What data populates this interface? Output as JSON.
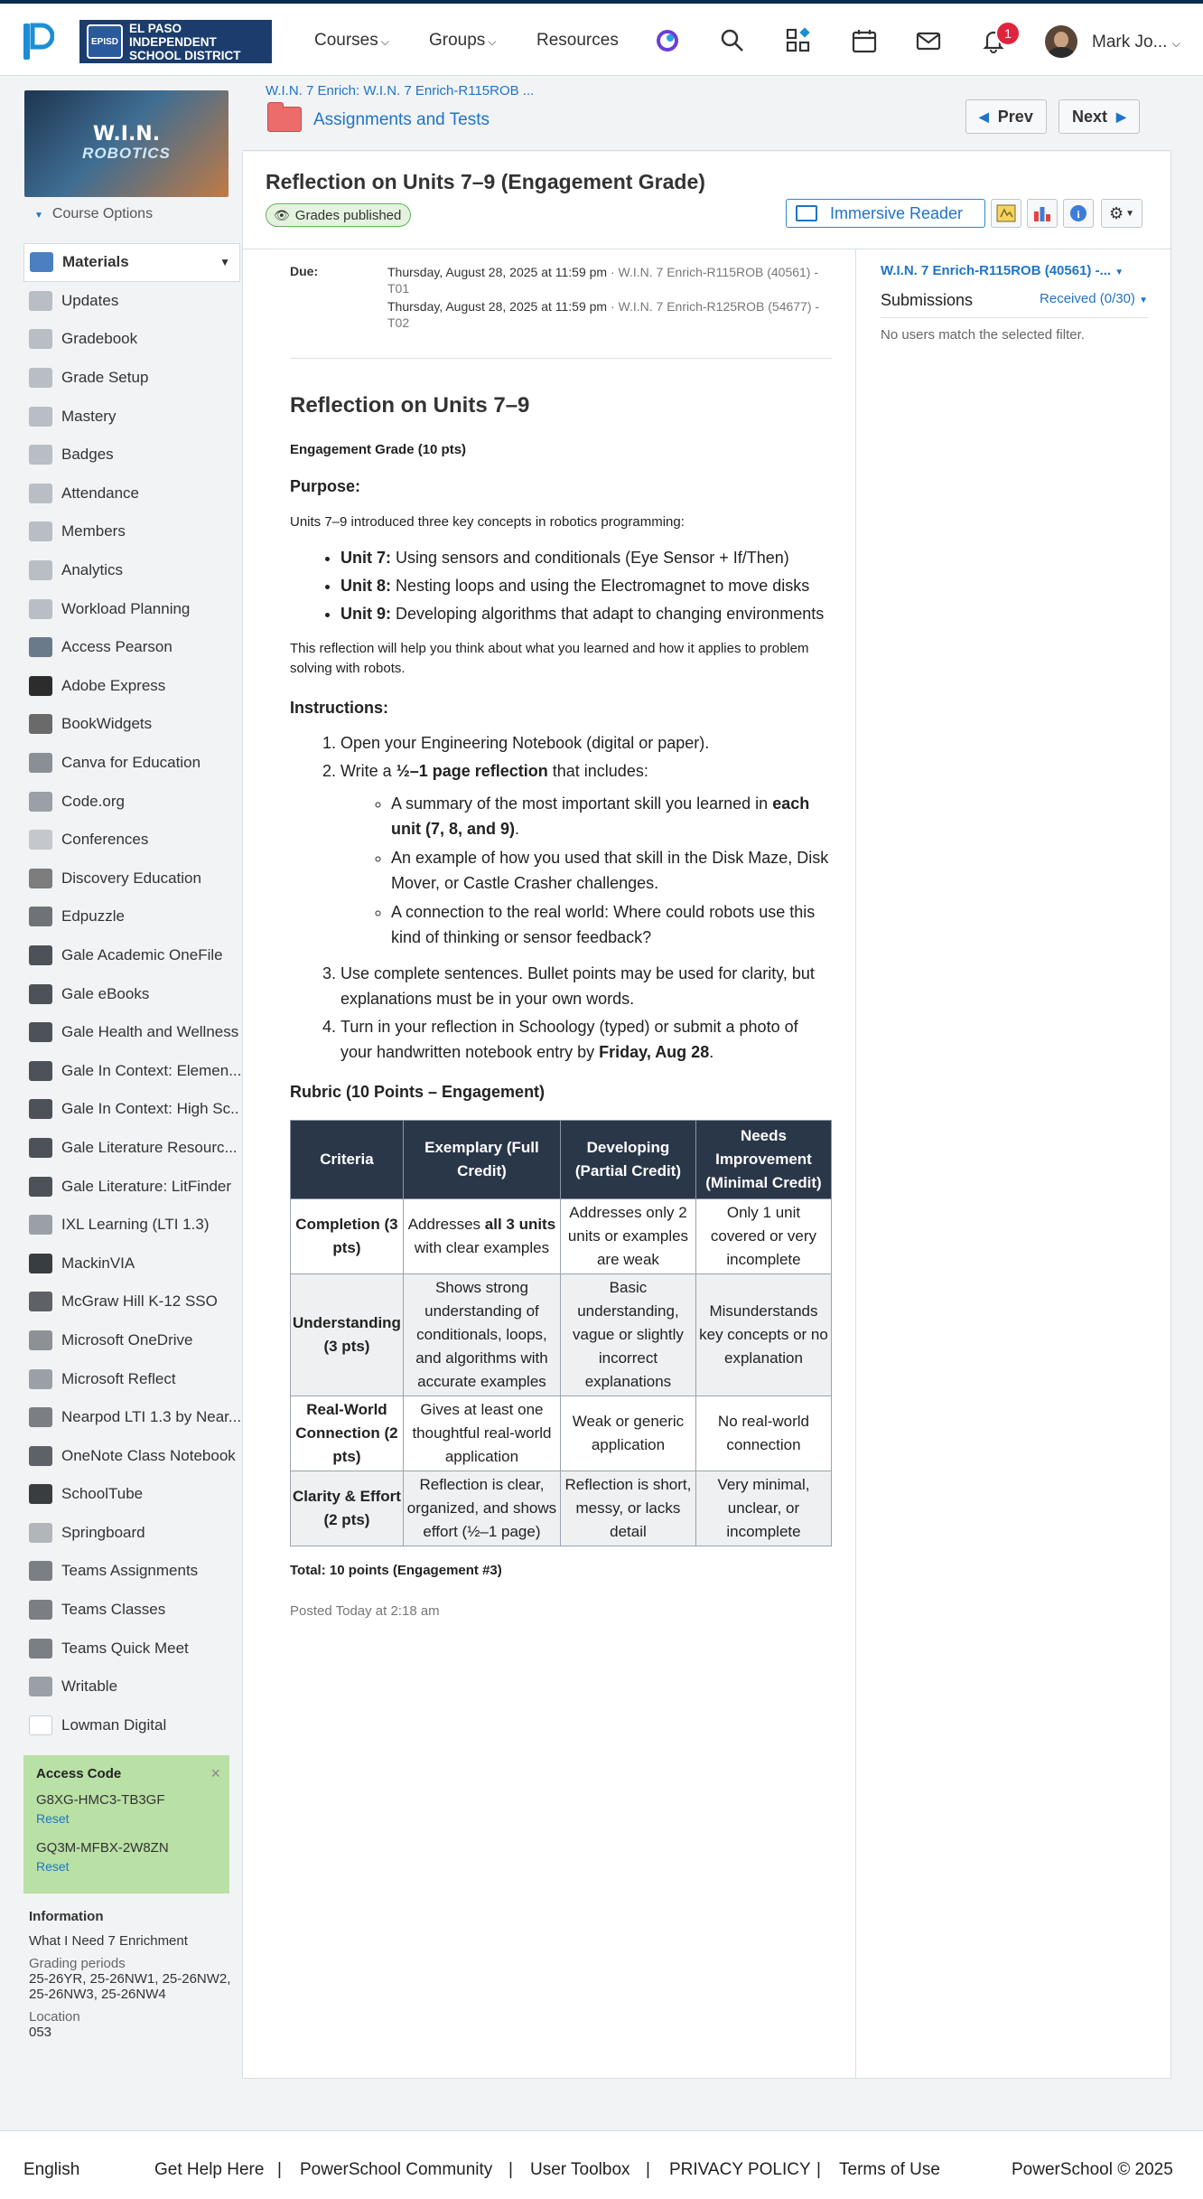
{
  "header": {
    "district_name_line1": "EL PASO INDEPENDENT",
    "district_name_line2": "SCHOOL DISTRICT",
    "district_seal": "EPISD",
    "nav": [
      "Courses",
      "Groups",
      "Resources"
    ],
    "notification_count": "1",
    "user_name": "Mark Jo..."
  },
  "sidebar": {
    "course_image_line1": "W.I.N.",
    "course_image_line2": "ROBOTICS",
    "course_options": "Course Options",
    "items": [
      {
        "label": "Materials",
        "icon": "materials-icon",
        "color": "#4a7fc1"
      },
      {
        "label": "Updates",
        "icon": "updates-icon",
        "color": "#b9bec4"
      },
      {
        "label": "Gradebook",
        "icon": "gradebook-icon",
        "color": "#b9bec4"
      },
      {
        "label": "Grade Setup",
        "icon": "grade-setup-icon",
        "color": "#b9bec4"
      },
      {
        "label": "Mastery",
        "icon": "mastery-icon",
        "color": "#b9bec4"
      },
      {
        "label": "Badges",
        "icon": "badges-icon",
        "color": "#b9bec4"
      },
      {
        "label": "Attendance",
        "icon": "attendance-icon",
        "color": "#b9bec4"
      },
      {
        "label": "Members",
        "icon": "members-icon",
        "color": "#b9bec4"
      },
      {
        "label": "Analytics",
        "icon": "analytics-icon",
        "color": "#b9bec4"
      },
      {
        "label": "Workload Planning",
        "icon": "workload-icon",
        "color": "#b9bec4"
      },
      {
        "label": "Access Pearson",
        "icon": "pearson-icon",
        "color": "#6a7a8a"
      },
      {
        "label": "Adobe Express",
        "icon": "adobe-icon",
        "color": "#2c2c2c"
      },
      {
        "label": "BookWidgets",
        "icon": "bookwidgets-icon",
        "color": "#6a6a6a"
      },
      {
        "label": "Canva for Education",
        "icon": "canva-icon",
        "color": "#8a8f95"
      },
      {
        "label": "Code.org",
        "icon": "codeorg-icon",
        "color": "#9aa0a6"
      },
      {
        "label": "Conferences",
        "icon": "conferences-icon",
        "color": "#c4c8cc"
      },
      {
        "label": "Discovery Education",
        "icon": "discovery-icon",
        "color": "#7d7d7d"
      },
      {
        "label": "Edpuzzle",
        "icon": "edpuzzle-icon",
        "color": "#6f7378"
      },
      {
        "label": "Gale Academic OneFile",
        "icon": "gale-icon",
        "color": "#4d5258"
      },
      {
        "label": "Gale eBooks",
        "icon": "gale-icon",
        "color": "#4d5258"
      },
      {
        "label": "Gale Health and Wellness",
        "icon": "gale-icon",
        "color": "#4d5258"
      },
      {
        "label": "Gale In Context: Elemen...",
        "icon": "gale-icon",
        "color": "#4d5258"
      },
      {
        "label": "Gale In Context: High Sc...",
        "icon": "gale-icon",
        "color": "#4d5258"
      },
      {
        "label": "Gale Literature Resourc...",
        "icon": "gale-icon",
        "color": "#4d5258"
      },
      {
        "label": "Gale Literature: LitFinder",
        "icon": "gale-icon",
        "color": "#4d5258"
      },
      {
        "label": "IXL Learning (LTI 1.3)",
        "icon": "ixl-icon",
        "color": "#9aa0a6"
      },
      {
        "label": "MackinVIA",
        "icon": "mackinvia-icon",
        "color": "#3a3d40"
      },
      {
        "label": "McGraw Hill K-12 SSO",
        "icon": "mcgrawhill-icon",
        "color": "#5e6165"
      },
      {
        "label": "Microsoft OneDrive",
        "icon": "onedrive-icon",
        "color": "#8d9196"
      },
      {
        "label": "Microsoft Reflect",
        "icon": "reflect-icon",
        "color": "#9aa0a6"
      },
      {
        "label": "Nearpod LTI 1.3 by Near...",
        "icon": "nearpod-icon",
        "color": "#7b7f84"
      },
      {
        "label": "OneNote Class Notebook",
        "icon": "onenote-icon",
        "color": "#5e6165"
      },
      {
        "label": "SchoolTube",
        "icon": "schooltube-icon",
        "color": "#3a3d40"
      },
      {
        "label": "Springboard",
        "icon": "springboard-icon",
        "color": "#b2b6ba"
      },
      {
        "label": "Teams Assignments",
        "icon": "teams-icon",
        "color": "#7b7f84"
      },
      {
        "label": "Teams Classes",
        "icon": "teams-icon",
        "color": "#7b7f84"
      },
      {
        "label": "Teams Quick Meet",
        "icon": "teams-icon",
        "color": "#7b7f84"
      },
      {
        "label": "Writable",
        "icon": "writable-icon",
        "color": "#9aa0a6"
      },
      {
        "label": "Lowman Digital",
        "icon": "lowman-icon",
        "color": "#ffffff"
      }
    ],
    "access": {
      "title": "Access Code",
      "codes": [
        "G8XG-HMC3-TB3GF",
        "GQ3M-MFBX-2W8ZN"
      ],
      "reset": "Reset",
      "bg_color": "#b9e0a5"
    },
    "information": {
      "heading": "Information",
      "course": "What I Need 7 Enrichment",
      "grading_label": "Grading periods",
      "grading_value": "25-26YR, 25-26NW1, 25-26NW2, 25-26NW3, 25-26NW4",
      "location_label": "Location",
      "location_value": "053"
    }
  },
  "main": {
    "breadcrumb": "W.I.N. 7 Enrich: W.I.N. 7 Enrich-R115ROB ...",
    "folder_label": "Assignments and Tests",
    "prev": "Prev",
    "next": "Next",
    "title": "Reflection on Units 7–9 (Engagement Grade)",
    "published": "Grades published",
    "immersive_reader": "Immersive Reader",
    "due_label": "Due:",
    "due_lines": [
      {
        "date": "Thursday, August 28, 2025 at 11:59 pm",
        "course": " · W.I.N. 7 Enrich-R115ROB (40561) - T01"
      },
      {
        "date": "Thursday, August 28, 2025 at 11:59 pm",
        "course": " · W.I.N. 7 Enrich-R125ROB (54677) - T02"
      }
    ],
    "body": {
      "heading": "Reflection on Units 7–9",
      "grade_note": "Engagement Grade (10 pts)",
      "purpose_h": "Purpose:",
      "purpose_p": "Units 7–9 introduced three key concepts in robotics programming:",
      "units": [
        {
          "b": "Unit 7:",
          "t": " Using sensors and conditionals (Eye Sensor + If/Then)"
        },
        {
          "b": "Unit 8:",
          "t": " Nesting loops and using the Electromagnet to move disks"
        },
        {
          "b": "Unit 9:",
          "t": " Developing algorithms that adapt to changing environments"
        }
      ],
      "purpose_p2": "This reflection will help you think about what you learned and how it applies to problem solving with robots.",
      "instructions_h": "Instructions:",
      "inst1": "Open your Engineering Notebook (digital or paper).",
      "inst2_pre": "Write a ",
      "inst2_b": "½–1 page reflection",
      "inst2_post": " that includes:",
      "sub1_pre": "A summary of the most important skill you learned in ",
      "sub1_b": "each unit (7, 8, and 9)",
      "sub1_post": ".",
      "sub2": "An example of how you used that skill in the Disk Maze, Disk Mover, or Castle Crasher challenges.",
      "sub3": "A connection to the real world: Where could robots use this kind of thinking or sensor feedback?",
      "inst3": "Use complete sentences. Bullet points may be used for clarity, but explanations must be in your own words.",
      "inst4_pre": "Turn in your reflection in Schoology (typed) or submit a photo of your handwritten notebook entry by ",
      "inst4_b": "Friday, Aug 28",
      "inst4_post": ".",
      "rubric_h": "Rubric (10 Points – Engagement)",
      "rubric_headers": [
        "Criteria",
        "Exemplary (Full Credit)",
        "Developing (Partial Credit)",
        "Needs Improvement (Minimal Credit)"
      ],
      "rubric_rows": [
        [
          "Completion (3 pts)",
          "Addresses all 3 units with clear examples",
          "Addresses only 2 units or examples are weak",
          "Only 1 unit covered or very incomplete"
        ],
        [
          "Understanding (3 pts)",
          "Shows strong understanding of conditionals, loops, and algorithms with accurate examples",
          "Basic understanding, vague or slightly incorrect explanations",
          "Misunderstands key concepts or no explanation"
        ],
        [
          "Real-World Connection (2 pts)",
          "Gives at least one thoughtful real-world application",
          "Weak or generic application",
          "No real-world connection"
        ],
        [
          "Clarity & Effort (2 pts)",
          "Reflection is clear, organized, and shows effort (½–1 page)",
          "Reflection is short, messy, or lacks detail",
          "Very minimal, unclear, or incomplete"
        ]
      ],
      "total": "Total: 10 points (Engagement #3)",
      "posted": "Posted Today at 2:18 am"
    },
    "right": {
      "section": "W.I.N. 7 Enrich-R115ROB (40561) -...",
      "submissions": "Submissions",
      "filter": "Received (0/30)",
      "empty": "No users match the selected filter."
    }
  },
  "footer": {
    "language": "English",
    "links": [
      "Get Help Here",
      "|",
      "PowerSchool Community",
      "|",
      "User Toolbox",
      "|",
      "PRIVACY POLICY",
      "|",
      "Terms of Use"
    ],
    "copyright": "PowerSchool © 2025"
  }
}
